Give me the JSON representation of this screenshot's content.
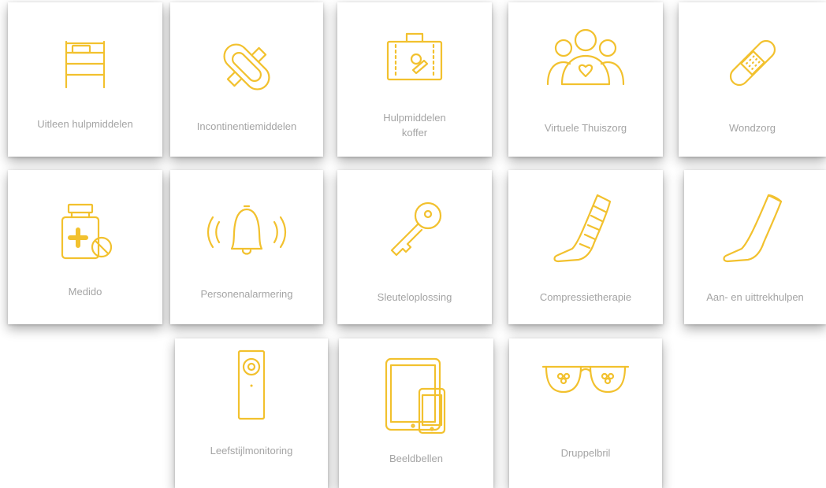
{
  "colors": {
    "icon": "#f2c12e",
    "label": "#a4a4a4",
    "tile": "#ffffff"
  },
  "tiles": [
    {
      "label": "Uitleen hulpmiddelen",
      "icon": "bed-icon"
    },
    {
      "label": "Incontinentiemiddelen",
      "icon": "pad-icon"
    },
    {
      "label": "Hulpmiddelen koffer",
      "icon": "suitcase-icon"
    },
    {
      "label": "Virtuele Thuiszorg",
      "icon": "people-heart-icon"
    },
    {
      "label": "Wondzorg",
      "icon": "bandage-icon"
    },
    {
      "label": "Medido",
      "icon": "medicine-jar-icon"
    },
    {
      "label": "Personenalarmering",
      "icon": "bell-alarm-icon"
    },
    {
      "label": "Sleuteloplossing",
      "icon": "key-icon"
    },
    {
      "label": "Compressietherapie",
      "icon": "compression-stocking-icon"
    },
    {
      "label": "Aan- en uittrekhulpen",
      "icon": "stocking-icon"
    },
    {
      "label": "Leefstijlmonitoring",
      "icon": "sensor-device-icon"
    },
    {
      "label": "Beeldbellen",
      "icon": "tablet-phone-icon"
    },
    {
      "label": "Druppelbril",
      "icon": "glasses-icon"
    }
  ]
}
